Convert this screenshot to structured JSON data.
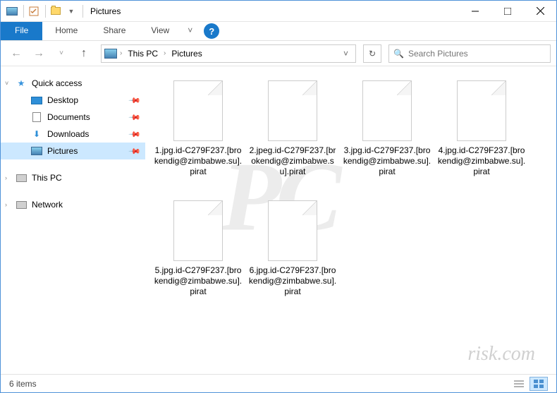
{
  "window": {
    "title": "Pictures"
  },
  "ribbon": {
    "file": "File",
    "tabs": [
      "Home",
      "Share",
      "View"
    ]
  },
  "breadcrumb": {
    "root": "This PC",
    "current": "Pictures"
  },
  "search": {
    "placeholder": "Search Pictures"
  },
  "sidebar": {
    "quick_access": "Quick access",
    "items": [
      {
        "label": "Desktop"
      },
      {
        "label": "Documents"
      },
      {
        "label": "Downloads"
      },
      {
        "label": "Pictures"
      }
    ],
    "this_pc": "This PC",
    "network": "Network"
  },
  "files": [
    {
      "name": "1.jpg.id-C279F237.[brokendig@zimbabwe.su].pirat"
    },
    {
      "name": "2.jpeg.id-C279F237.[brokendig@zimbabwe.su].pirat"
    },
    {
      "name": "3.jpg.id-C279F237.[brokendig@zimbabwe.su].pirat"
    },
    {
      "name": "4.jpg.id-C279F237.[brokendig@zimbabwe.su].pirat"
    },
    {
      "name": "5.jpg.id-C279F237.[brokendig@zimbabwe.su].pirat"
    },
    {
      "name": "6.jpg.id-C279F237.[brokendig@zimbabwe.su].pirat"
    }
  ],
  "status": {
    "count": "6 items"
  },
  "watermark": {
    "big": "PC",
    "small": "risk.com"
  }
}
